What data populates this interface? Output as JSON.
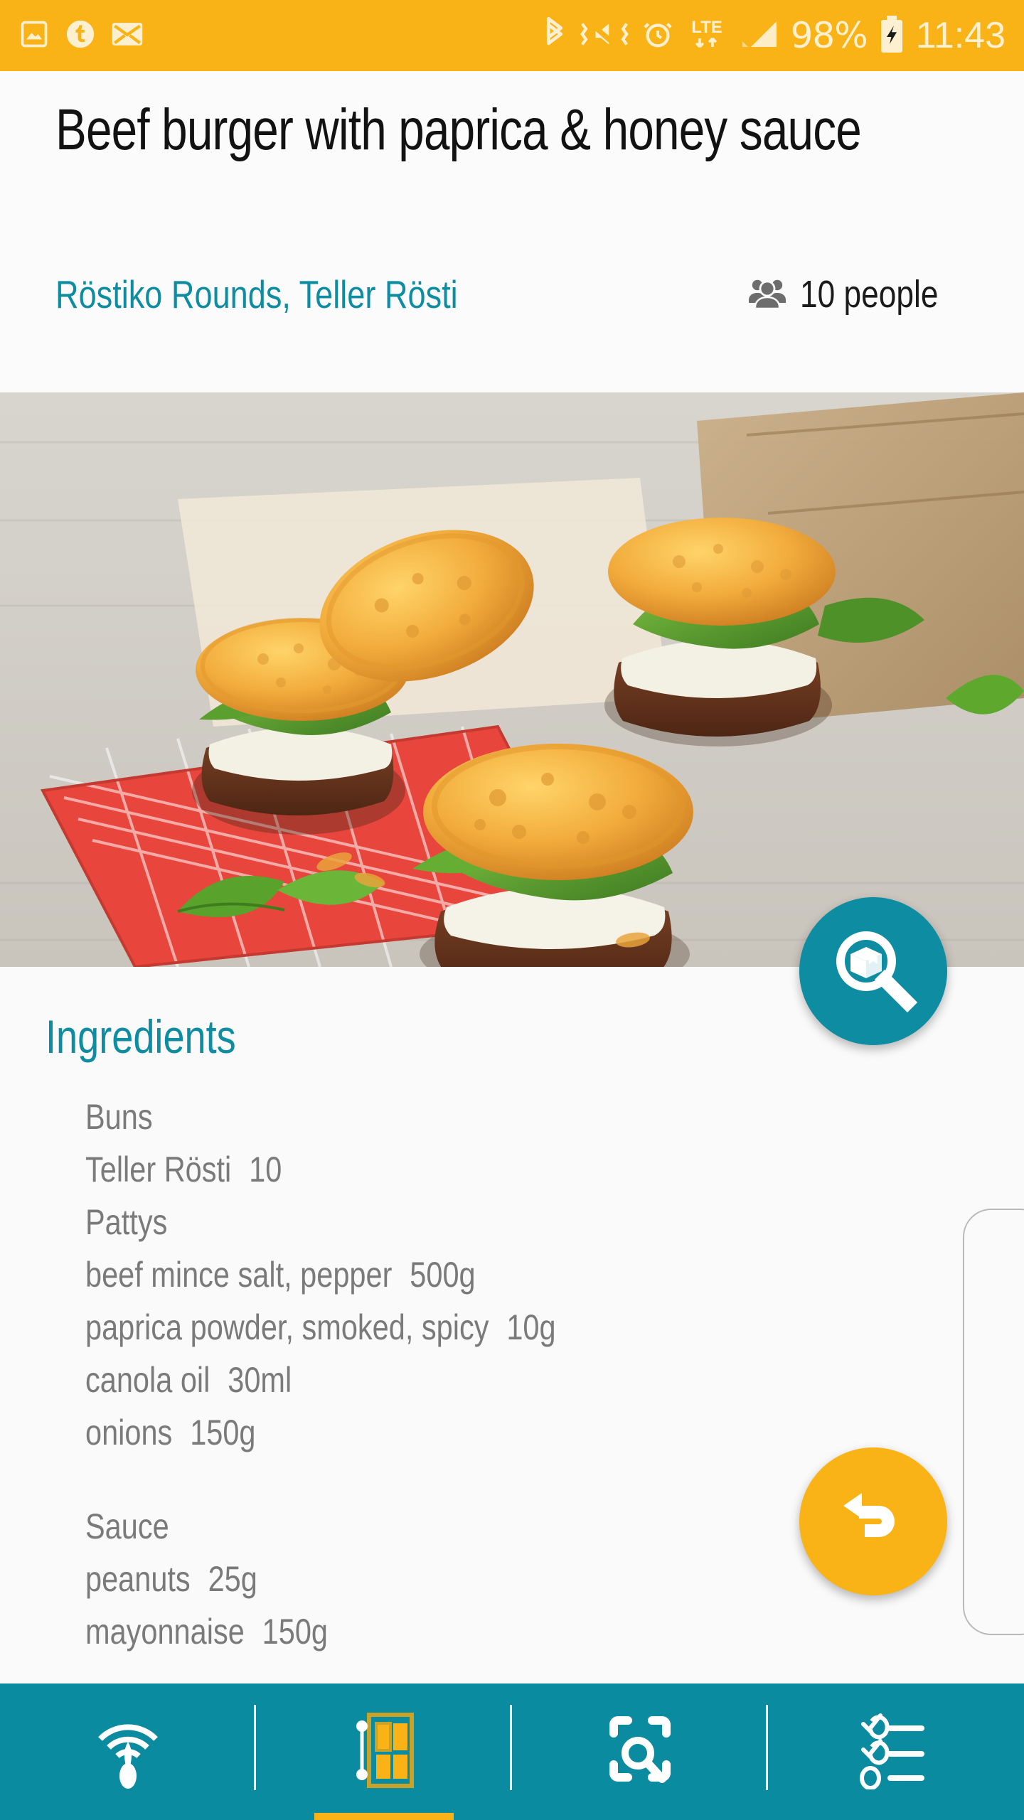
{
  "statusbar": {
    "left_icons": [
      "image-icon",
      "tumblr-notification-icon",
      "mail-icon"
    ],
    "right_icons": [
      "bluetooth-icon",
      "mute-vibrate-icon",
      "alarm-icon",
      "lte-icon",
      "signal-icon",
      "battery-charging-icon"
    ],
    "lte_label": "LTE",
    "battery_label": "98%",
    "time": "11:43",
    "background": "#F9B316",
    "foreground": "#FDF0D0"
  },
  "header": {
    "title": "Beef burger with paprica & honey sauce",
    "subtitle": "Röstiko Rounds, Teller Rösti",
    "people_icon": "people-icon",
    "people_label": "10 people",
    "accent_color": "#0E8CA2"
  },
  "photo": {
    "alt": "Mini beef burgers with rösti buns, spinach and sauce on a red checkered napkin"
  },
  "ingredients": {
    "heading": "Ingredients",
    "groups": [
      {
        "name": "Buns",
        "items": [
          {
            "name": "Teller Rösti",
            "amount": "10"
          }
        ]
      },
      {
        "name": "Pattys",
        "items": [
          {
            "name": "beef mince salt, pepper",
            "amount": "500g"
          },
          {
            "name": "paprica powder, smoked, spicy",
            "amount": "10g"
          },
          {
            "name": "canola oil",
            "amount": "30ml"
          },
          {
            "name": "onions",
            "amount": "150g"
          }
        ]
      },
      {
        "name": "Sauce",
        "items": [
          {
            "name": "peanuts",
            "amount": "25g"
          },
          {
            "name": "mayonnaise",
            "amount": "150g"
          }
        ]
      }
    ]
  },
  "fabs": [
    {
      "name": "product-search-fab",
      "icon": "box-magnifier-icon",
      "color": "#0D8CA2"
    },
    {
      "name": "back-fab",
      "icon": "undo-arrow-icon",
      "color": "#F9B316"
    }
  ],
  "navbar": {
    "background": "#0A8BA0",
    "active_index": 1,
    "items": [
      {
        "icon": "beacon-icon",
        "active": false
      },
      {
        "icon": "planogram-shelf-icon",
        "active": true
      },
      {
        "icon": "scan-search-icon",
        "active": false
      },
      {
        "icon": "checklist-icon",
        "active": false
      }
    ]
  }
}
